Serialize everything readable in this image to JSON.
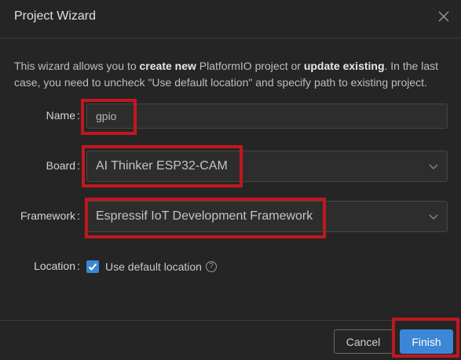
{
  "dialog": {
    "title": "Project Wizard",
    "intro": {
      "part1": "This wizard allows you to ",
      "bold1": "create new",
      "part2": " PlatformIO project or ",
      "bold2": "update existing",
      "part3": ". In the last case, you need to uncheck \"Use default location\" and specify path to existing project."
    }
  },
  "form": {
    "name": {
      "label": "Name",
      "colon": ":",
      "value": "gpio"
    },
    "board": {
      "label": "Board",
      "colon": ":",
      "value": "AI Thinker ESP32-CAM"
    },
    "framework": {
      "label": "Framework",
      "colon": ":",
      "value": "Espressif IoT Development Framework"
    },
    "location": {
      "label": "Location",
      "colon": ":",
      "checkbox_label": "Use default location",
      "checked": true,
      "help_glyph": "?"
    }
  },
  "footer": {
    "cancel_label": "Cancel",
    "finish_label": "Finish"
  },
  "colors": {
    "background": "#252526",
    "accent": "#3b87d6",
    "highlight": "#c0171f"
  },
  "icons": {
    "close": "close-icon",
    "chevron": "chevron-down-icon",
    "check": "checkmark-icon",
    "help": "help-icon"
  }
}
